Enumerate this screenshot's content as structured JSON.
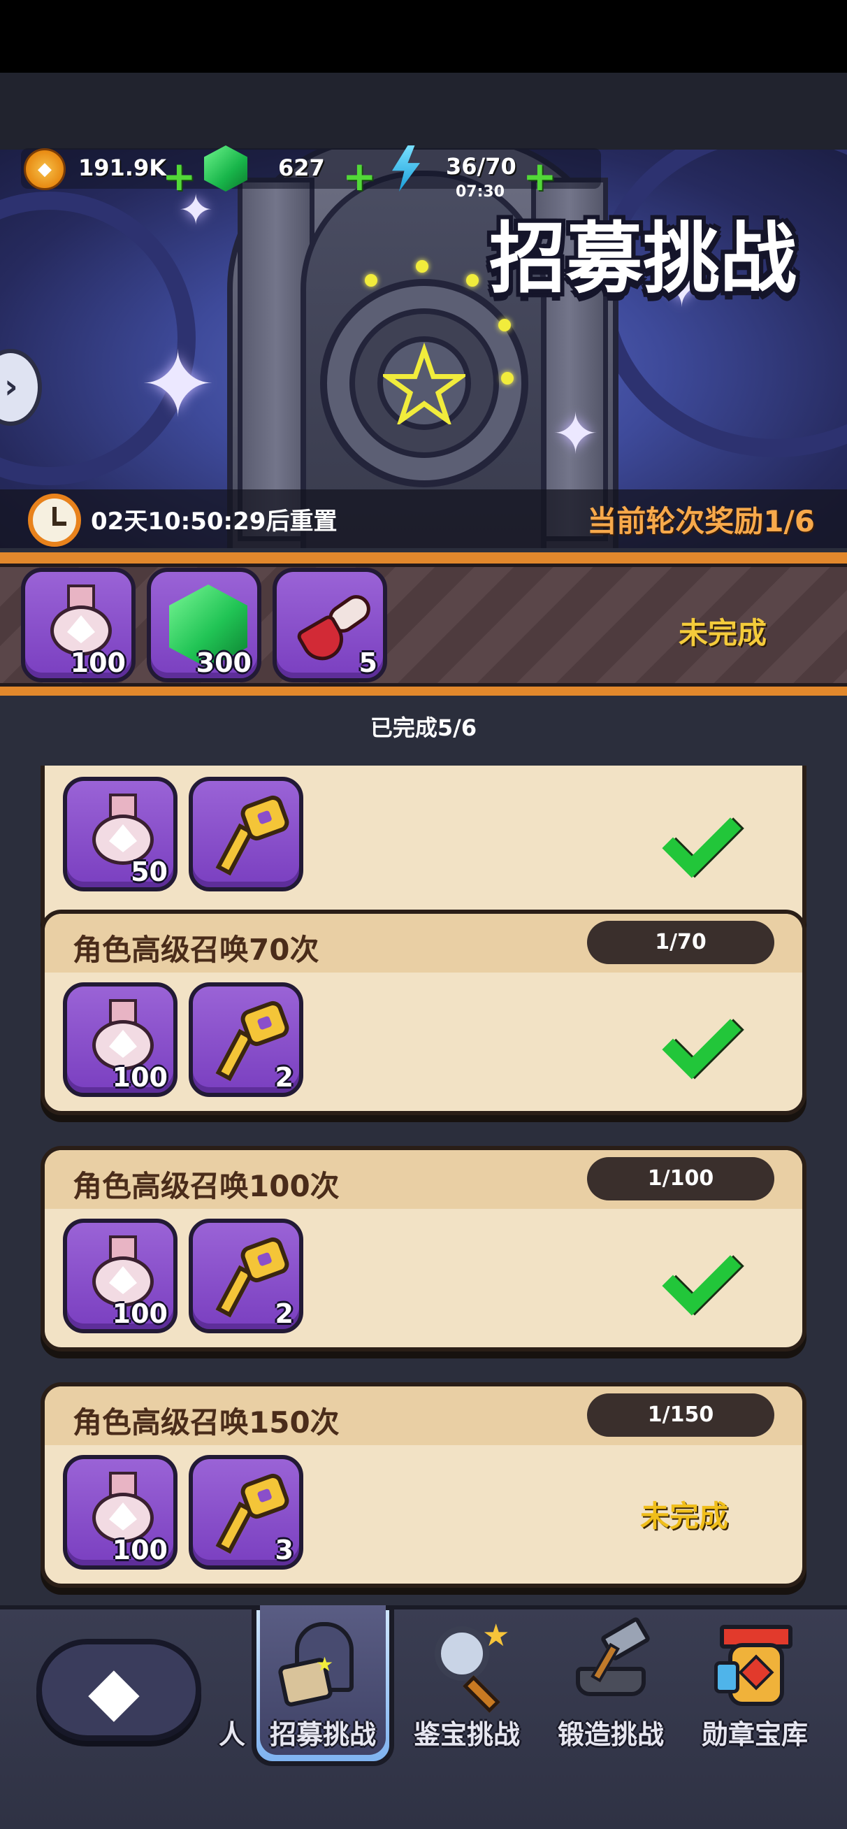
{
  "currency": {
    "coins": "191.9K",
    "gems": "627",
    "energy": "36/70",
    "energy_timer": "07:30"
  },
  "banner": {
    "title": "招募挑战",
    "reset_timer": "02天10:50:29后重置",
    "round_reward": "当前轮次奖励1/6"
  },
  "current_reward": {
    "items": [
      {
        "icon": "medal-icon",
        "qty": "100"
      },
      {
        "icon": "emerald-icon",
        "qty": "300"
      },
      {
        "icon": "horn-icon",
        "qty": "5"
      }
    ],
    "status": "未完成"
  },
  "progress_label": "已完成5/6",
  "tasks": [
    {
      "title": "",
      "progress": "",
      "items": [
        {
          "icon": "medal-icon",
          "qty": "50"
        },
        {
          "icon": "key-icon",
          "qty": ""
        }
      ],
      "status": "done"
    },
    {
      "title": "角色高级召唤70次",
      "progress": "1/70",
      "items": [
        {
          "icon": "medal-icon",
          "qty": "100"
        },
        {
          "icon": "key-icon",
          "qty": "2"
        }
      ],
      "status": "done"
    },
    {
      "title": "角色高级召唤100次",
      "progress": "1/100",
      "items": [
        {
          "icon": "medal-icon",
          "qty": "100"
        },
        {
          "icon": "key-icon",
          "qty": "2"
        }
      ],
      "status": "done"
    },
    {
      "title": "角色高级召唤150次",
      "progress": "1/150",
      "items": [
        {
          "icon": "medal-icon",
          "qty": "100"
        },
        {
          "icon": "key-icon",
          "qty": "3"
        }
      ],
      "status": "未完成"
    }
  ],
  "bottom_nav": {
    "back_icon": "back-arrow-icon",
    "partial_label": "人",
    "items": [
      {
        "label": "招募挑战",
        "icon": "recruit-challenge-icon",
        "active": true
      },
      {
        "label": "鉴宝挑战",
        "icon": "magnifier-icon",
        "active": false
      },
      {
        "label": "锻造挑战",
        "icon": "anvil-hammer-icon",
        "active": false
      },
      {
        "label": "勋章宝库",
        "icon": "medal-vault-icon",
        "active": false
      }
    ]
  },
  "colors": {
    "accent_orange": "#e2882c",
    "done_green": "#22c63a",
    "pending_yellow": "#f0be1b",
    "card_bg": "#f2e2c5",
    "item_purple": "#8a4fca"
  }
}
